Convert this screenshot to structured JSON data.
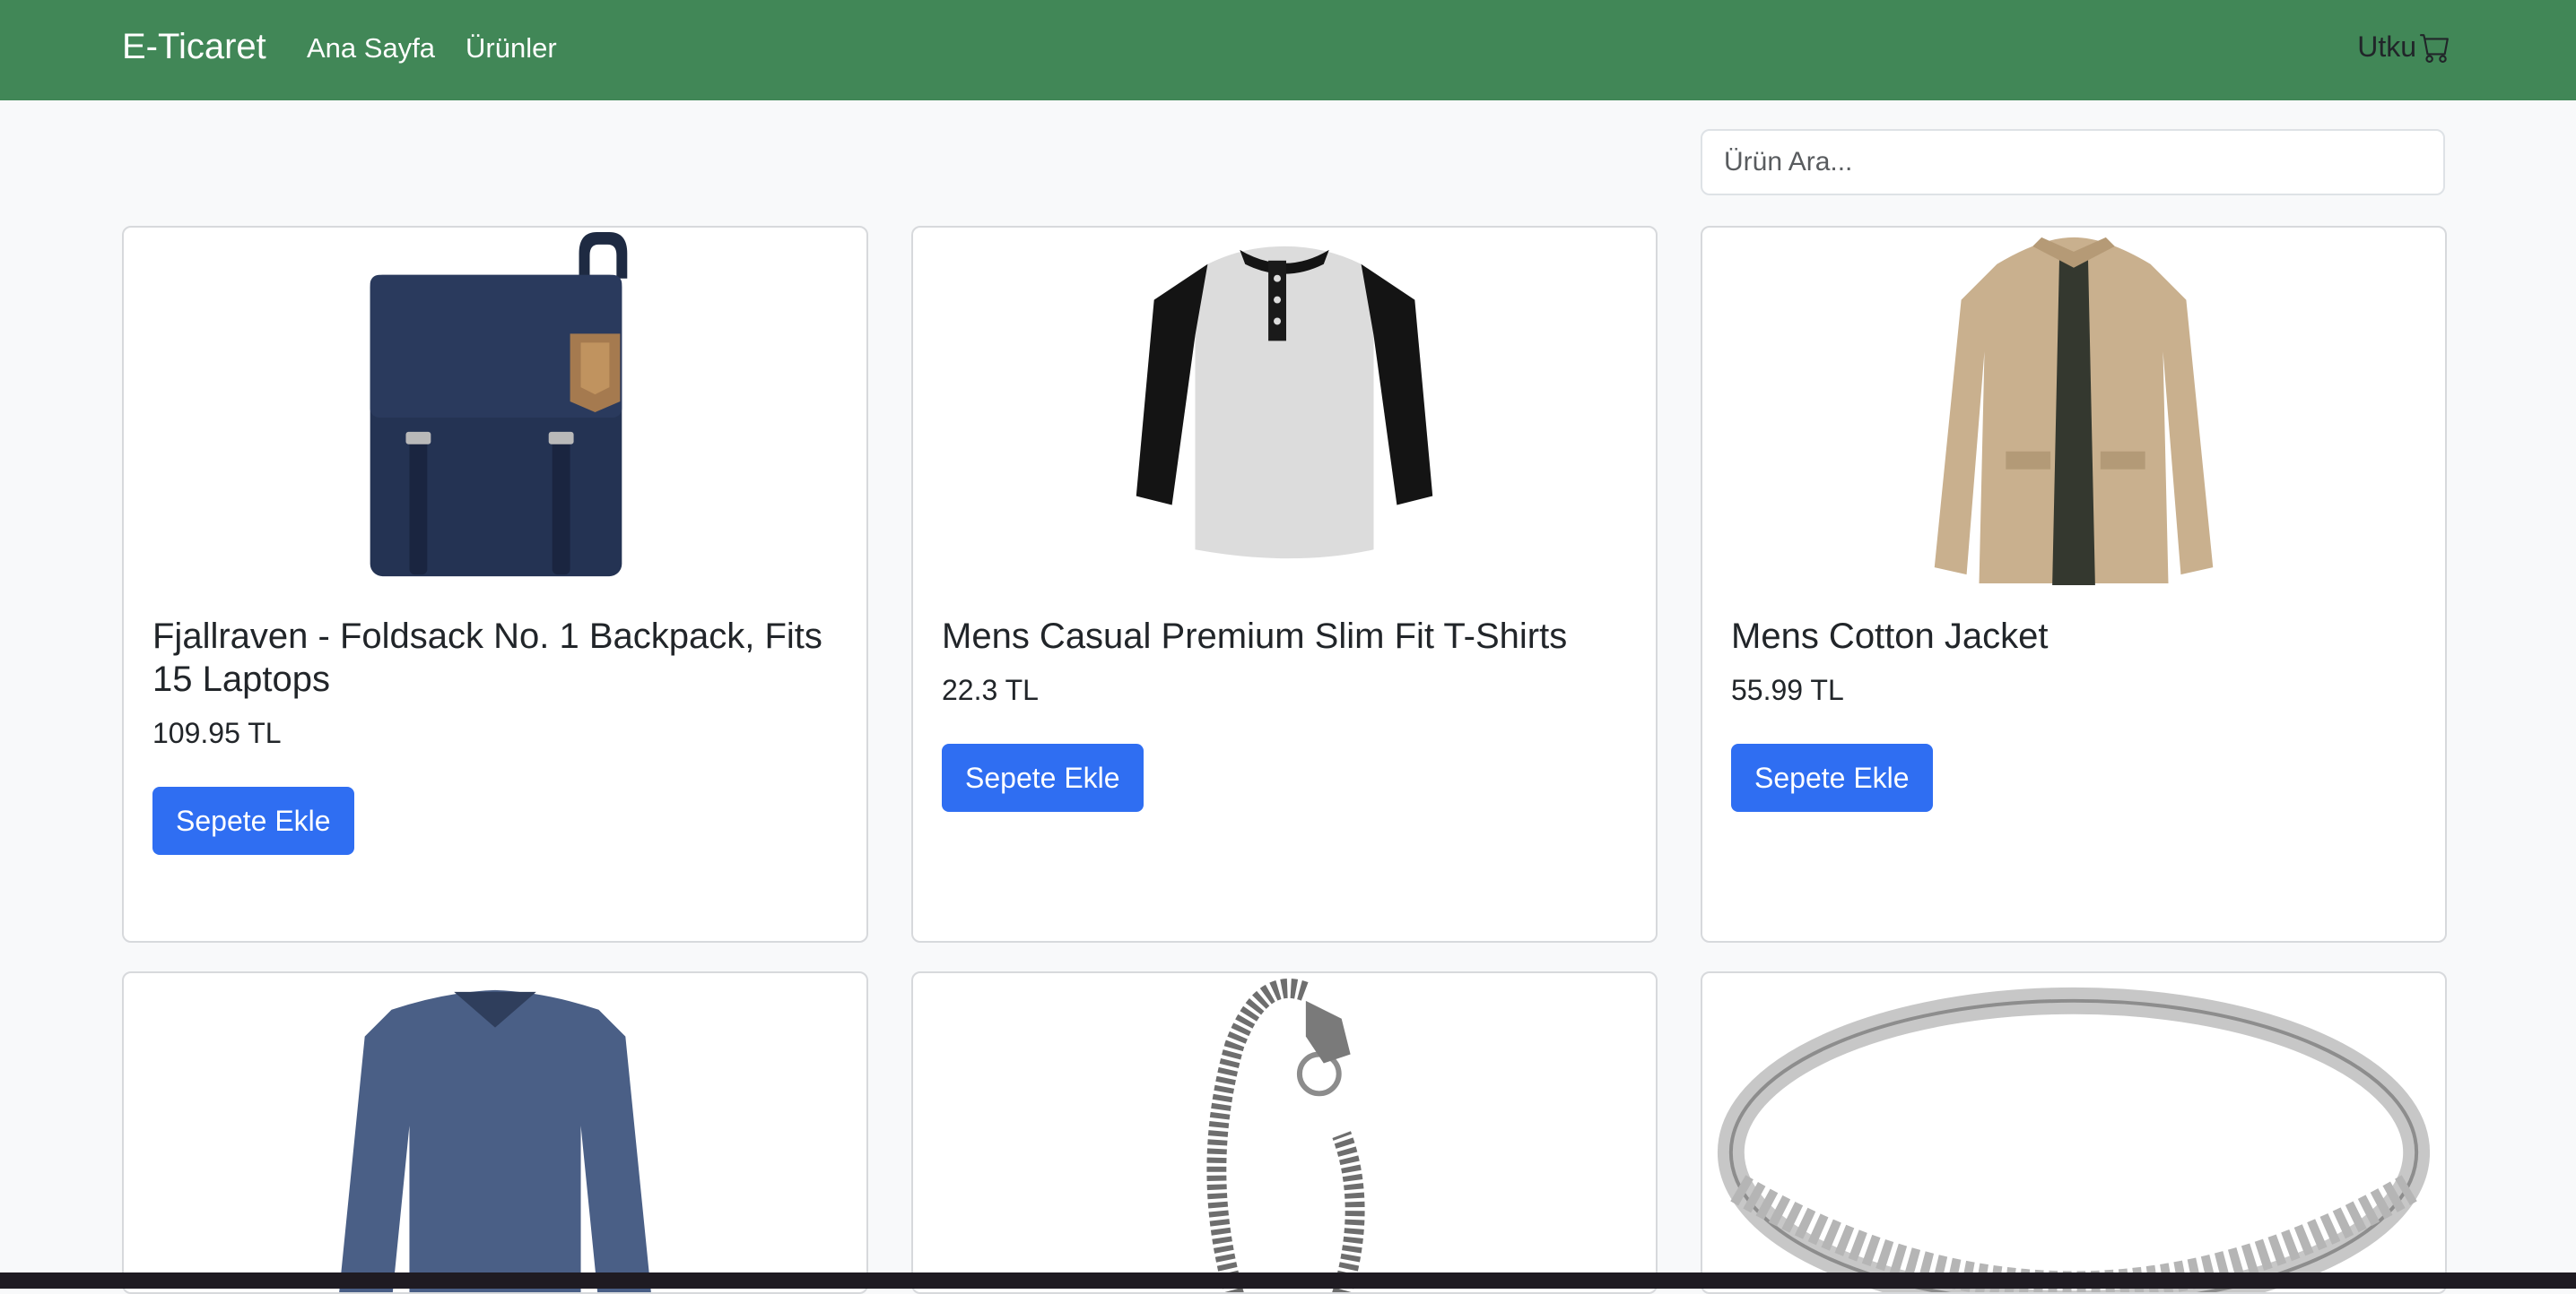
{
  "navbar": {
    "brand": "E-Ticaret",
    "links": [
      "Ana Sayfa",
      "Ürünler"
    ],
    "user": "Utku",
    "cart_icon": "cart-icon",
    "bg_color": "#418757"
  },
  "search": {
    "placeholder": "Ürün Ara..."
  },
  "products": [
    {
      "title": "Fjallraven - Foldsack No. 1 Backpack, Fits 15 Laptops",
      "price": "109.95 TL",
      "button": "Sepete Ekle",
      "image": "backpack"
    },
    {
      "title": "Mens Casual Premium Slim Fit T-Shirts",
      "price": "22.3 TL",
      "button": "Sepete Ekle",
      "image": "t-shirt"
    },
    {
      "title": "Mens Cotton Jacket",
      "price": "55.99 TL",
      "button": "Sepete Ekle",
      "image": "jacket"
    },
    {
      "image": "long-sleeve-shirt"
    },
    {
      "image": "chain-bracelet"
    },
    {
      "image": "silver-ring"
    }
  ],
  "accent_color": "#2f6ef2"
}
